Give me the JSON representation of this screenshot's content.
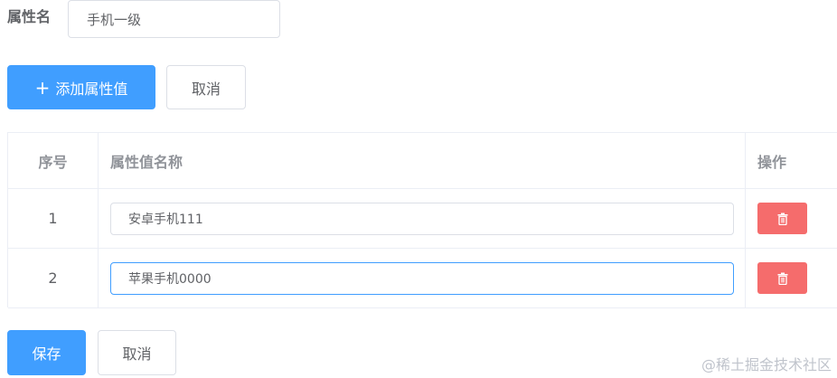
{
  "attribute": {
    "label": "属性名",
    "value": "手机一级"
  },
  "actions": {
    "add_icon": "+",
    "add_label": "添加属性值",
    "cancel_label": "取消"
  },
  "table": {
    "columns": [
      "序号",
      "属性值名称",
      "操作"
    ],
    "rows": [
      {
        "index": "1",
        "value": "安卓手机111",
        "focused": false
      },
      {
        "index": "2",
        "value": "苹果手机0000",
        "focused": true
      }
    ],
    "delete_icon": "trash-icon"
  },
  "footer": {
    "save_label": "保存",
    "cancel_label": "取消"
  },
  "watermark": "@稀土掘金技术社区",
  "colors": {
    "primary": "#409eff",
    "danger": "#f56c6c",
    "border": "#dcdfe6",
    "header_text": "#909399"
  }
}
